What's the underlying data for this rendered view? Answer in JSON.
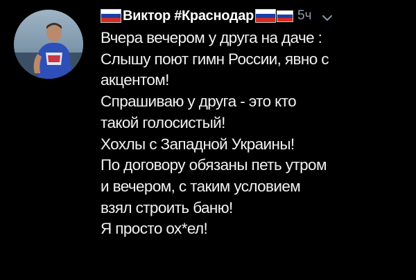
{
  "tweet": {
    "author_name": "Виктор #Краснодар",
    "time": "5ч",
    "lines": [
      "Вчера вечером у друга на даче :",
      "Слышу поют гимн России, явно с",
      "акцентом!",
      "Спрашиваю у друга - это кто",
      "такой голосистый!",
      "Хохлы с Западной Украины!",
      "По договору обязаны петь утром",
      "и вечером, с таким условием",
      "взял строить баню!",
      "Я просто ох*ел!"
    ]
  },
  "icons": {
    "avatar": "user-avatar",
    "flag": "russian-flag-icon",
    "menu": "chevron-down-icon"
  },
  "colors": {
    "background": "#000000",
    "text": "#f2f2f2",
    "muted": "#8b98a5",
    "flag_white": "#ffffff",
    "flag_blue": "#1c3fa8",
    "flag_red": "#d52b1e"
  }
}
